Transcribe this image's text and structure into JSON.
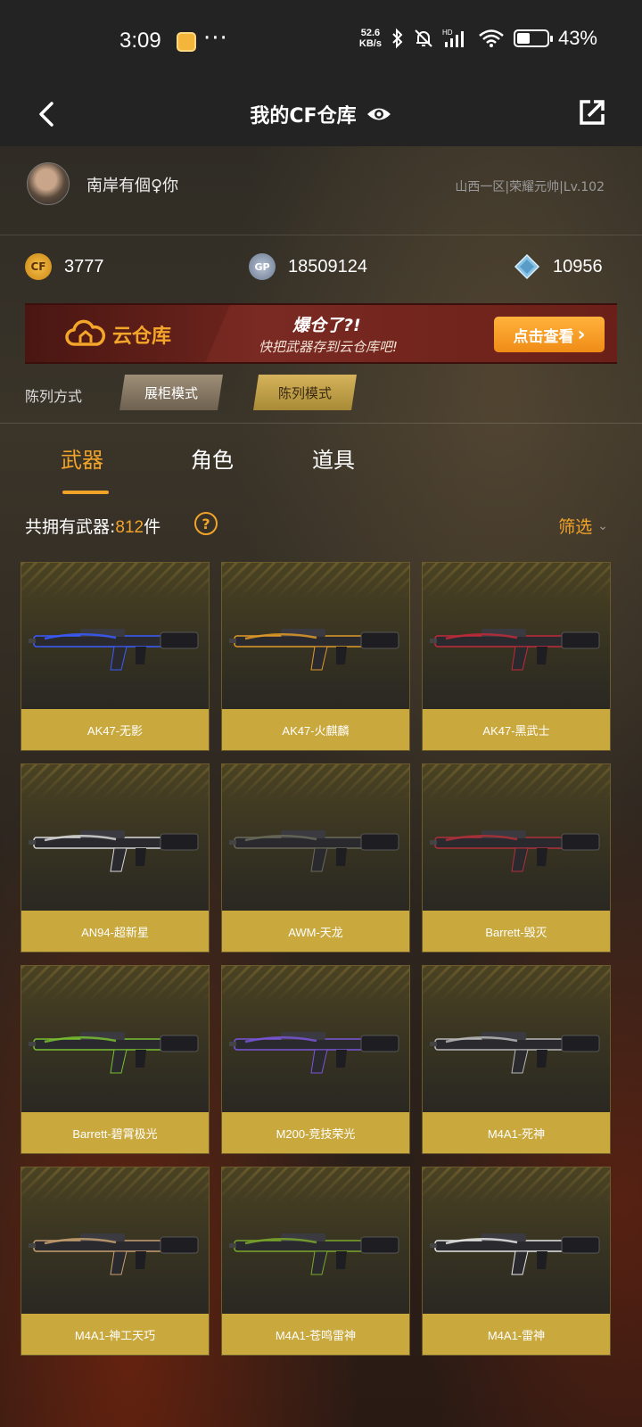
{
  "status_bar": {
    "time": "3:09",
    "dots": "···",
    "net_speed_value": "52.6",
    "net_speed_unit": "KB/s",
    "battery_level": 0.43,
    "battery_text": "43%"
  },
  "header": {
    "title": "我的CF仓库"
  },
  "profile": {
    "nickname": "南岸有個♀你",
    "server_info": "山西一区|荣耀元帅|Lv.102"
  },
  "currency": {
    "cf_points": "3777",
    "gp": "18509124",
    "diamonds": "10956",
    "gp_badge": "GP"
  },
  "banner": {
    "cloud_label": "云仓库",
    "slogan_main": "爆仓了?!",
    "slogan_sub": "快把武器存到云仓库吧!",
    "button_label": "点击查看",
    "button_arrow": "›"
  },
  "display_mode": {
    "label": "陈列方式",
    "showcase": "展柜模式",
    "list": "陈列模式"
  },
  "tabs": {
    "weapons": "武器",
    "characters": "角色",
    "items": "道具"
  },
  "summary": {
    "label": "共拥有武器:",
    "count": "812",
    "unit": "件",
    "help": "?",
    "filter": "筛选",
    "filter_chevron": "⌄"
  },
  "weapons": [
    {
      "name": "AK47-无影",
      "accent": "#3a5cff"
    },
    {
      "name": "AK47-火麒麟",
      "accent": "#e09a28"
    },
    {
      "name": "AK47-黑武士",
      "accent": "#c02a3a"
    },
    {
      "name": "AN94-超新星",
      "accent": "#d8d8d8"
    },
    {
      "name": "AWM-天龙",
      "accent": "#6a6a5a"
    },
    {
      "name": "Barrett-毁灭",
      "accent": "#b0303a"
    },
    {
      "name": "Barrett-碧霄极光",
      "accent": "#78c030"
    },
    {
      "name": "M200-竞技荣光",
      "accent": "#7a56d8"
    },
    {
      "name": "M4A1-死神",
      "accent": "#b8b8b8"
    },
    {
      "name": "M4A1-神工天巧",
      "accent": "#c8a070"
    },
    {
      "name": "M4A1-苍鸣雷神",
      "accent": "#7aa82a"
    },
    {
      "name": "M4A1-雷神",
      "accent": "#e8e8e8"
    }
  ]
}
